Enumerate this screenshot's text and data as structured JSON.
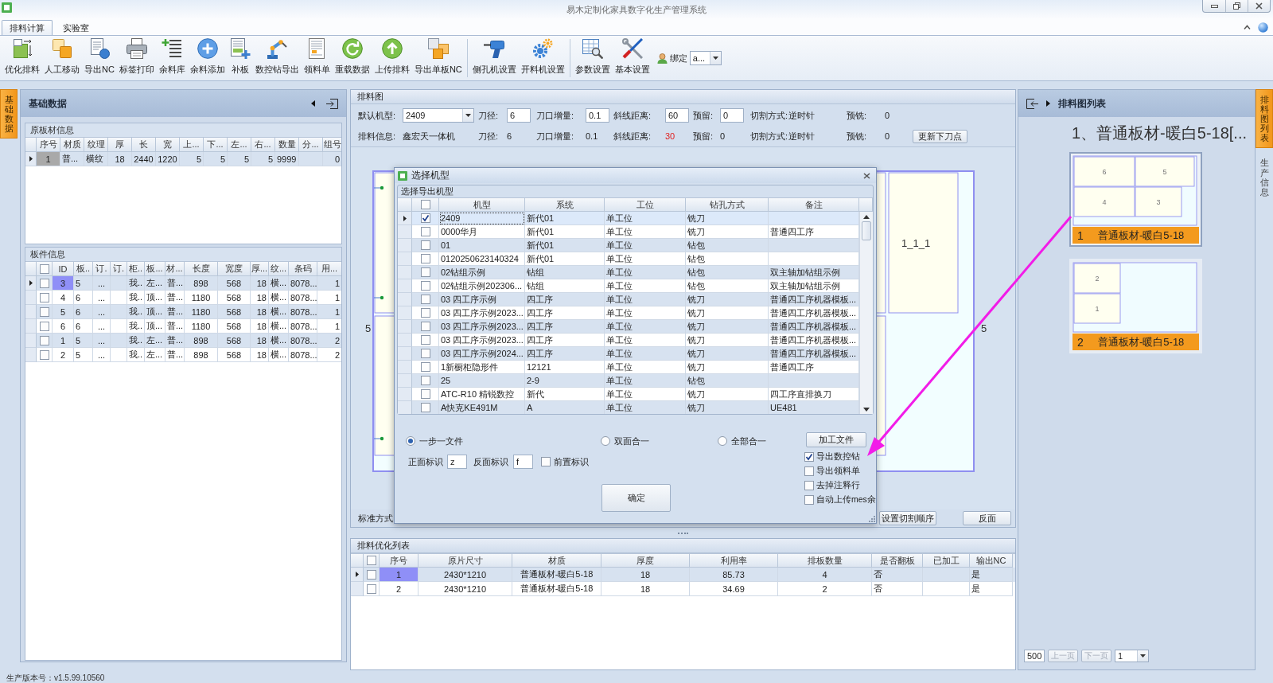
{
  "window": {
    "title": "易木定制化家具数字化生产管理系统"
  },
  "ribbon": {
    "tabs": [
      {
        "label": "排料计算",
        "selected": true
      },
      {
        "label": "实验室",
        "selected": false
      }
    ],
    "groups": [
      [
        {
          "kind": "optimize",
          "label": "优化排料"
        },
        {
          "kind": "move",
          "label": "人工移动"
        },
        {
          "kind": "export_nc",
          "label": "导出NC"
        },
        {
          "kind": "print",
          "label": "标签打印"
        },
        {
          "kind": "remnant_list",
          "label": "余料库"
        },
        {
          "kind": "add",
          "label": "余料添加"
        },
        {
          "kind": "patch",
          "label": "补板"
        },
        {
          "kind": "robot",
          "label": "数控钻导出"
        },
        {
          "kind": "sheet",
          "label": "领料单"
        },
        {
          "kind": "reload",
          "label": "重载数据"
        },
        {
          "kind": "upload",
          "label": "上传排料"
        },
        {
          "kind": "export_single",
          "label": "导出单板NC"
        }
      ],
      [
        {
          "kind": "drill",
          "label": "侧孔机设置"
        },
        {
          "kind": "gears",
          "label": "开料机设置"
        }
      ],
      [
        {
          "kind": "params",
          "label": "参数设置"
        },
        {
          "kind": "tools",
          "label": "基本设置"
        }
      ]
    ],
    "bind": {
      "label": "绑定",
      "value": "a..."
    }
  },
  "left_dock": [
    {
      "label": "基础数据",
      "selected": true
    }
  ],
  "base_data": {
    "title": "基础数据",
    "boards": {
      "title": "原板材信息",
      "columns": [
        "序号",
        "材质",
        "纹理",
        "厚",
        "长",
        "宽",
        "上...",
        "下...",
        "左...",
        "右...",
        "数量",
        "分...",
        "组号"
      ],
      "rows": [
        {
          "selected": true,
          "cells": [
            "1",
            "普...",
            "横纹",
            "18",
            "2440",
            "1220",
            "5",
            "5",
            "5",
            "5",
            "9999",
            null,
            "0"
          ]
        }
      ]
    },
    "parts": {
      "title": "板件信息",
      "select_all": false,
      "columns": [
        "ID",
        "板..",
        "订.",
        "订.",
        "柜..",
        "板...",
        "材...",
        "长度",
        "宽度",
        "厚...",
        "纹...",
        "条码",
        "用..."
      ],
      "rows": [
        {
          "selected": true,
          "checked": false,
          "cells": [
            "3",
            "5",
            "...",
            null,
            "我..",
            "左...",
            "普...",
            "898",
            "568",
            "18",
            "横...",
            "8078...",
            "1"
          ]
        },
        {
          "selected": false,
          "checked": false,
          "cells": [
            "4",
            "6",
            "...",
            null,
            "我..",
            "顶...",
            "普...",
            "1180",
            "568",
            "18",
            "横...",
            "8078...",
            "1"
          ]
        },
        {
          "selected": false,
          "checked": false,
          "cells": [
            "5",
            "6",
            "...",
            null,
            "我..",
            "顶...",
            "普...",
            "1180",
            "568",
            "18",
            "横...",
            "8078...",
            "1"
          ]
        },
        {
          "selected": false,
          "checked": false,
          "cells": [
            "6",
            "6",
            "...",
            null,
            "我..",
            "顶...",
            "普...",
            "1180",
            "568",
            "18",
            "横...",
            "8078...",
            "1"
          ]
        },
        {
          "selected": false,
          "checked": false,
          "cells": [
            "1",
            "5",
            "...",
            null,
            "我..",
            "左...",
            "普...",
            "898",
            "568",
            "18",
            "横...",
            "8078...",
            "2"
          ]
        },
        {
          "selected": false,
          "checked": false,
          "cells": [
            "2",
            "5",
            "...",
            null,
            "我..",
            "左...",
            "普...",
            "898",
            "568",
            "18",
            "横...",
            "8078...",
            "2"
          ]
        }
      ]
    }
  },
  "layout": {
    "title": "排料图",
    "settings": [
      {
        "kind": "combo",
        "label": "默认机型:",
        "value": "2409"
      },
      {
        "kind": "input",
        "label": "刀径:",
        "value": "6"
      },
      {
        "kind": "input",
        "label": "刀口增量:",
        "value": "0.1"
      },
      {
        "kind": "input",
        "label": "斜线距离:",
        "value": "60"
      },
      {
        "kind": "input",
        "label": "预留:",
        "value": "0"
      },
      {
        "kind": "text",
        "label": "切割方式:",
        "value": "逆时针"
      },
      {
        "kind": "text",
        "label": "预铣:",
        "value": "0"
      }
    ],
    "info": [
      {
        "label": "排料信息:",
        "value": "鑫宏天一体机",
        "warn": false
      },
      {
        "label": "刀径:",
        "value": "6",
        "warn": false
      },
      {
        "label": "刀口增量:",
        "value": "0.1",
        "warn": false
      },
      {
        "label": "斜线距离:",
        "value": "30",
        "warn": true
      },
      {
        "label": "预留:",
        "value": "0",
        "warn": false
      },
      {
        "label": "切割方式:",
        "value": "逆时针",
        "warn": false
      },
      {
        "label": "预铣:",
        "value": "0",
        "warn": false
      }
    ],
    "update_button": "更新下刀点",
    "canvas": {
      "part_label": "1_1_1",
      "edge_labels": [
        "5",
        "5"
      ]
    },
    "mode_label": "标准方式",
    "buttons": [
      "设置切割顺序",
      "反面"
    ]
  },
  "result_list": {
    "title": "排料优化列表",
    "select_all": false,
    "columns": [
      "序号",
      "原片尺寸",
      "材质",
      "厚度",
      "利用率",
      "排板数量",
      "是否翻板",
      "已加工",
      "输出NC"
    ],
    "rows": [
      {
        "selected": true,
        "checked": false,
        "cells": [
          "1",
          "2430*1210",
          "普通板材-暖白5-18",
          "18",
          "85.73",
          "4",
          "否",
          null,
          "是"
        ]
      },
      {
        "selected": false,
        "checked": false,
        "cells": [
          "2",
          "2430*1210",
          "普通板材-暖白5-18",
          "18",
          "34.69",
          "2",
          "否",
          null,
          "是"
        ]
      }
    ]
  },
  "sheet_list": {
    "title": "排料图列表",
    "heading": "1、普通板材-暖白5-18[...",
    "sheets": [
      {
        "number": "1",
        "material": "普通板材-暖白5-18",
        "selected": true,
        "parts": [
          "6",
          "5",
          "4",
          "3"
        ]
      },
      {
        "number": "2",
        "material": "普通板材-暖白5-18",
        "selected": false,
        "parts": [
          "2",
          "1"
        ]
      }
    ],
    "pager": {
      "page_size": "500",
      "prev": {
        "label": "上一页",
        "disabled": true
      },
      "next": {
        "label": "下一页",
        "disabled": true
      },
      "page": "1"
    }
  },
  "right_dock": [
    {
      "label": "排料图列表",
      "selected": true
    },
    {
      "label": "生产信息",
      "selected": false
    }
  ],
  "dialog": {
    "title": "选择机型",
    "group": "选择导出机型",
    "select_all": false,
    "columns": [
      "机型",
      "系统",
      "工位",
      "钻孔方式",
      "备注"
    ],
    "rows": [
      {
        "selected": true,
        "checked": true,
        "cells": [
          "2409",
          "新代01",
          "单工位",
          "铣刀",
          null
        ]
      },
      {
        "selected": false,
        "checked": false,
        "cells": [
          "0000华月",
          "新代01",
          "单工位",
          "铣刀",
          "普通四工序"
        ]
      },
      {
        "selected": false,
        "checked": false,
        "cells": [
          "01",
          "新代01",
          "单工位",
          "钻包",
          null
        ]
      },
      {
        "selected": false,
        "checked": false,
        "cells": [
          "0120250623140324",
          "新代01",
          "单工位",
          "钻包",
          null
        ]
      },
      {
        "selected": false,
        "checked": false,
        "cells": [
          "02钻组示例",
          "钻组",
          "单工位",
          "钻包",
          "双主轴加钻组示例"
        ]
      },
      {
        "selected": false,
        "checked": false,
        "cells": [
          "02钻组示例202306...",
          "钻组",
          "单工位",
          "钻包",
          "双主轴加钻组示例"
        ]
      },
      {
        "selected": false,
        "checked": false,
        "cells": [
          "03 四工序示例",
          "四工序",
          "单工位",
          "铣刀",
          "普通四工序机器模板..."
        ]
      },
      {
        "selected": false,
        "checked": false,
        "cells": [
          "03 四工序示例2023...",
          "四工序",
          "单工位",
          "铣刀",
          "普通四工序机器模板..."
        ]
      },
      {
        "selected": false,
        "checked": false,
        "cells": [
          "03 四工序示例2023...",
          "四工序",
          "单工位",
          "铣刀",
          "普通四工序机器模板..."
        ]
      },
      {
        "selected": false,
        "checked": false,
        "cells": [
          "03 四工序示例2023...",
          "四工序",
          "单工位",
          "铣刀",
          "普通四工序机器模板..."
        ]
      },
      {
        "selected": false,
        "checked": false,
        "cells": [
          "03 四工序示例2024...",
          "四工序",
          "单工位",
          "铣刀",
          "普通四工序机器模板..."
        ]
      },
      {
        "selected": false,
        "checked": false,
        "cells": [
          "1新橱柜隐形件",
          "12121",
          "单工位",
          "铣刀",
          "普通四工序"
        ]
      },
      {
        "selected": false,
        "checked": false,
        "cells": [
          "25",
          "2-9",
          "单工位",
          "钻包",
          null
        ]
      },
      {
        "selected": false,
        "checked": false,
        "cells": [
          "ATC-R10 精锐数控",
          "新代",
          "单工位",
          "铣刀",
          "四工序直排换刀"
        ]
      },
      {
        "selected": false,
        "checked": false,
        "cells": [
          "A快克KE491M",
          "A",
          "单工位",
          "铣刀",
          "UE481"
        ]
      }
    ],
    "modes": [
      {
        "label": "一步一文件",
        "selected": true
      },
      {
        "label": "双面合一",
        "selected": false
      },
      {
        "label": "全部合一",
        "selected": false
      }
    ],
    "front_mark": {
      "label": "正面标识",
      "value": "z"
    },
    "back_mark": {
      "label": "反面标识",
      "value": "f"
    },
    "prefix_mark": {
      "label": "前置标识",
      "checked": false
    },
    "file_button": "加工文件",
    "options": [
      {
        "label": "导出数控钻",
        "checked": true
      },
      {
        "label": "导出领料单",
        "checked": false
      },
      {
        "label": "去掉注释行",
        "checked": false
      },
      {
        "label": "自动上传mes余",
        "checked": false
      }
    ],
    "ok_button": "确定"
  },
  "status_bar": {
    "text": "生产版本号：v1.5.99.10560"
  }
}
